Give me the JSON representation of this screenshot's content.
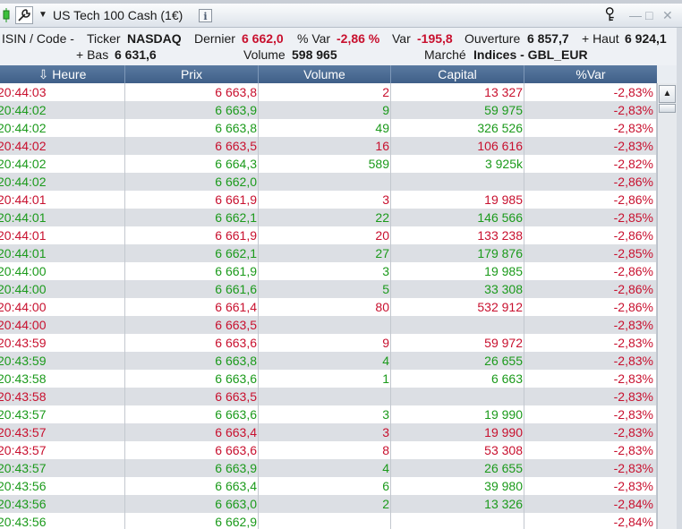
{
  "window": {
    "title": "US Tech 100 Cash (1€)",
    "info_label": "i",
    "minimize": "—",
    "maximize": "□",
    "close": "✕"
  },
  "infobar": {
    "isin_label": "ISIN / Code -",
    "ticker_label": "Ticker",
    "ticker": "NASDAQ",
    "dernier_label": "Dernier",
    "dernier": "6 662,0",
    "pvar_label": "% Var",
    "pvar": "-2,86 %",
    "var_label": "Var",
    "var": "-195,8",
    "ouverture_label": "Ouverture",
    "ouverture": "6 857,7",
    "haut_label": "+ Haut",
    "haut": "6 924,1",
    "bas_label": "+ Bas",
    "bas": "6 631,6",
    "volume_label": "Volume",
    "volume": "598 965",
    "marche_label": "Marché",
    "marche": "Indices - GBL_EUR"
  },
  "columns": [
    "Heure",
    "Prix",
    "Volume",
    "Capital",
    "%Var"
  ],
  "sort_arrow": "⇩",
  "scroll_up": "▲",
  "colors": {
    "up": "#1b9a1b",
    "down": "#c8102e",
    "header": "#4a6a92"
  },
  "rows": [
    {
      "time": "20:44:03",
      "price": "6 663,8",
      "vol": "2",
      "cap": "13 327",
      "pct": "-2,83%",
      "c": "r"
    },
    {
      "time": "20:44:02",
      "price": "6 663,9",
      "vol": "9",
      "cap": "59 975",
      "pct": "-2,83%",
      "c": "g"
    },
    {
      "time": "20:44:02",
      "price": "6 663,8",
      "vol": "49",
      "cap": "326 526",
      "pct": "-2,83%",
      "c": "g"
    },
    {
      "time": "20:44:02",
      "price": "6 663,5",
      "vol": "16",
      "cap": "106 616",
      "pct": "-2,83%",
      "c": "r"
    },
    {
      "time": "20:44:02",
      "price": "6 664,3",
      "vol": "589",
      "cap": "3 925k",
      "pct": "-2,82%",
      "c": "g"
    },
    {
      "time": "20:44:02",
      "price": "6 662,0",
      "vol": "",
      "cap": "",
      "pct": "-2,86%",
      "c": "g"
    },
    {
      "time": "20:44:01",
      "price": "6 661,9",
      "vol": "3",
      "cap": "19 985",
      "pct": "-2,86%",
      "c": "r"
    },
    {
      "time": "20:44:01",
      "price": "6 662,1",
      "vol": "22",
      "cap": "146 566",
      "pct": "-2,85%",
      "c": "g"
    },
    {
      "time": "20:44:01",
      "price": "6 661,9",
      "vol": "20",
      "cap": "133 238",
      "pct": "-2,86%",
      "c": "r"
    },
    {
      "time": "20:44:01",
      "price": "6 662,1",
      "vol": "27",
      "cap": "179 876",
      "pct": "-2,85%",
      "c": "g"
    },
    {
      "time": "20:44:00",
      "price": "6 661,9",
      "vol": "3",
      "cap": "19 985",
      "pct": "-2,86%",
      "c": "g"
    },
    {
      "time": "20:44:00",
      "price": "6 661,6",
      "vol": "5",
      "cap": "33 308",
      "pct": "-2,86%",
      "c": "g"
    },
    {
      "time": "20:44:00",
      "price": "6 661,4",
      "vol": "80",
      "cap": "532 912",
      "pct": "-2,86%",
      "c": "r"
    },
    {
      "time": "20:44:00",
      "price": "6 663,5",
      "vol": "",
      "cap": "",
      "pct": "-2,83%",
      "c": "r"
    },
    {
      "time": "20:43:59",
      "price": "6 663,6",
      "vol": "9",
      "cap": "59 972",
      "pct": "-2,83%",
      "c": "r"
    },
    {
      "time": "20:43:59",
      "price": "6 663,8",
      "vol": "4",
      "cap": "26 655",
      "pct": "-2,83%",
      "c": "g"
    },
    {
      "time": "20:43:58",
      "price": "6 663,6",
      "vol": "1",
      "cap": "6 663",
      "pct": "-2,83%",
      "c": "g"
    },
    {
      "time": "20:43:58",
      "price": "6 663,5",
      "vol": "",
      "cap": "",
      "pct": "-2,83%",
      "c": "r"
    },
    {
      "time": "20:43:57",
      "price": "6 663,6",
      "vol": "3",
      "cap": "19 990",
      "pct": "-2,83%",
      "c": "g"
    },
    {
      "time": "20:43:57",
      "price": "6 663,4",
      "vol": "3",
      "cap": "19 990",
      "pct": "-2,83%",
      "c": "r"
    },
    {
      "time": "20:43:57",
      "price": "6 663,6",
      "vol": "8",
      "cap": "53 308",
      "pct": "-2,83%",
      "c": "r"
    },
    {
      "time": "20:43:57",
      "price": "6 663,9",
      "vol": "4",
      "cap": "26 655",
      "pct": "-2,83%",
      "c": "g"
    },
    {
      "time": "20:43:56",
      "price": "6 663,4",
      "vol": "6",
      "cap": "39 980",
      "pct": "-2,83%",
      "c": "g"
    },
    {
      "time": "20:43:56",
      "price": "6 663,0",
      "vol": "2",
      "cap": "13 326",
      "pct": "-2,84%",
      "c": "g"
    },
    {
      "time": "20:43:56",
      "price": "6 662,9",
      "vol": "",
      "cap": "",
      "pct": "-2,84%",
      "c": "g"
    }
  ]
}
